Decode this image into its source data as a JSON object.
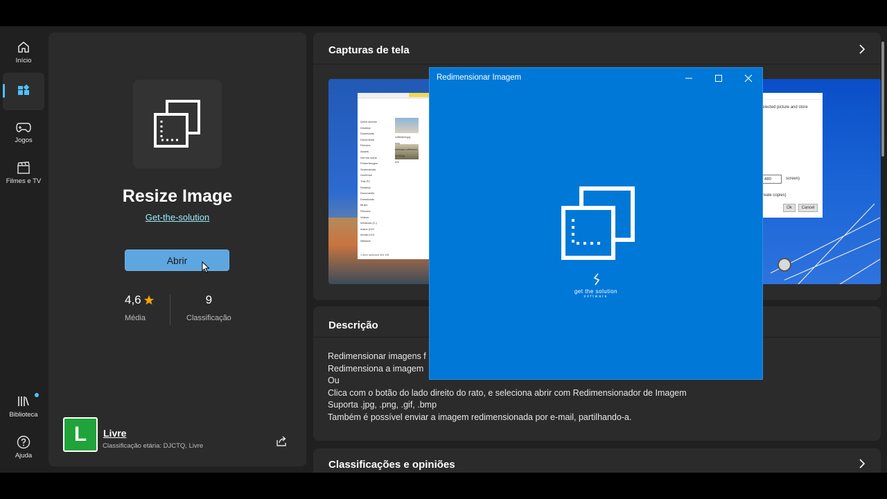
{
  "nav": {
    "items": [
      {
        "label": "Início"
      },
      {
        "label": ""
      },
      {
        "label": "Jogos"
      },
      {
        "label": "Filmes e TV"
      },
      {
        "label": "Biblioteca"
      },
      {
        "label": "Ajuda"
      }
    ]
  },
  "app": {
    "name": "Resize Image",
    "publisher": "Get-the-solution",
    "open_label": "Abrir",
    "rating_value": "4,6",
    "rating_label": "Média",
    "reviews_count": "9",
    "reviews_label": "Classificação",
    "age_rating_letter": "L",
    "age_rating_title": "Livre",
    "age_rating_sub": "Classificação etária: DJCTQ, Livre",
    "colors": {
      "accent": "#5ea6e0",
      "star": "#f7a500",
      "age_badge": "#1fa33a",
      "link": "#99ebff"
    }
  },
  "screenshots": {
    "title": "Capturas de tela",
    "left_shot": {
      "nav_items": [
        "Quick access",
        "Desktop",
        "Downloads",
        "Documents",
        "Pictures",
        "Assets",
        "Get the soluti",
        "PrinterImages",
        "Screenshots",
        "OneDrive",
        "This PC",
        "Desktop",
        "Documents",
        "Downloads",
        "Music",
        "Pictures",
        "Videos",
        "Windows (C:)",
        "mainz (\\\\10.",
        "media (\\\\10.",
        "Network"
      ],
      "thumb_captions": [
        "coffeeshot.jpg",
        "loop",
        "fsddsasd coffeeshot-small.jpg",
        "lvrs"
      ],
      "status": "1 item selected  461 KB"
    },
    "right_shot": {
      "line1": "elected picture and store",
      "width_value": "480",
      "screen_text": "screen)",
      "copies_text": "reate copies)",
      "ok": "Ok",
      "cancel": "Cancel"
    }
  },
  "dialog": {
    "title": "Redimensionar Imagem",
    "splash_line1": "get the solution",
    "splash_line2": "software"
  },
  "description": {
    "title": "Descrição",
    "lines": [
      "Redimensionar imagens f",
      "Redimensiona a imagem",
      "Ou",
      "Clica com o botão do lado direito do rato, e seleciona abrir com Redimensionador de Imagem",
      "Suporta .jpg, .png, .gif, .bmp",
      "Também é possível enviar a imagem redimensionada por e-mail, partilhando-a."
    ]
  },
  "reviews": {
    "title": "Classificações e opiniões"
  }
}
